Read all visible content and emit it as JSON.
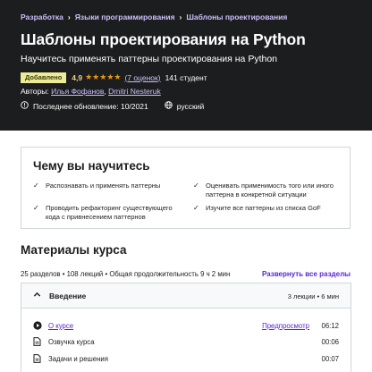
{
  "breadcrumbs": [
    "Разработка",
    "Языки программирования",
    "Шаблоны проектирования"
  ],
  "course": {
    "title": "Шаблоны проектирования на Python",
    "subtitle": "Научитесь применять паттерны проектирования на Python",
    "badge": "Добавлено",
    "rating": "4,9",
    "stars": "★★★★★",
    "reviews": "(7 оценок)",
    "students": "141 студент",
    "authors_label": "Авторы:",
    "authors": [
      "Илья Фофанов",
      "Dmitri Nesteruk"
    ],
    "updated": "Последнее обновление: 10/2021",
    "language": "русский"
  },
  "learn": {
    "heading": "Чему вы научитесь",
    "items": [
      "Распознавать и применять паттерны",
      "Оценивать применимость того или иного паттерна в конкретной ситуации",
      "Проводить рефакторинг существующего кода с привнесением паттернов",
      "Изучите все паттерны из списка GoF"
    ]
  },
  "materials": {
    "heading": "Материалы курса",
    "summary": "25 разделов • 108 лекций • Общая продолжительность 9 ч 2 мин",
    "expand_label": "Развернуть все разделы",
    "section": {
      "name": "Введение",
      "count": "3 лекции • 6 мин",
      "lectures": [
        {
          "title": "О курсе",
          "icon": "play-icon",
          "preview": "Предпросмотр",
          "duration": "06:12"
        },
        {
          "title": "Озвучка курса",
          "icon": "file-icon",
          "duration": "00:06"
        },
        {
          "title": "Задачи и решения",
          "icon": "file-icon",
          "duration": "00:07"
        }
      ]
    }
  },
  "colors": {
    "header_bg": "#1c1d1f",
    "link_light": "#cec0fc",
    "accent": "#5624d0",
    "badge_bg": "#eceb98",
    "star": "#e59819"
  }
}
